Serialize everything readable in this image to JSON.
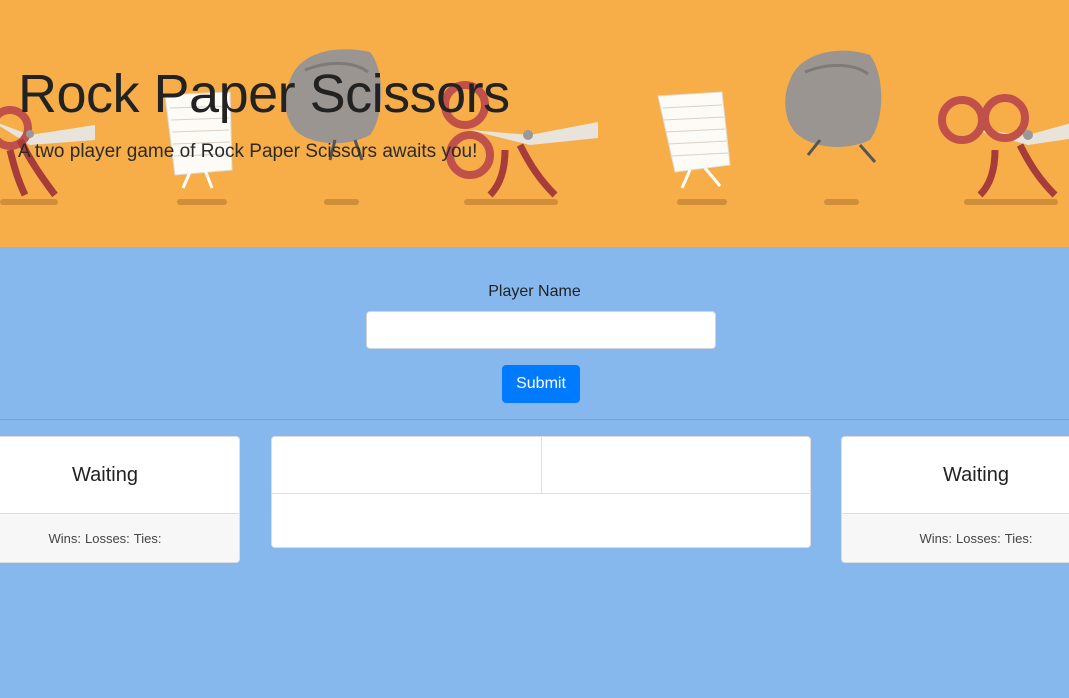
{
  "header": {
    "title": "Rock Paper Scissors",
    "subtitle": "A two player game of Rock Paper Scissors awaits you!",
    "banner_icons": [
      "scissors-icon",
      "paper-icon",
      "rock-icon"
    ],
    "background_color": "#f7ae48"
  },
  "form": {
    "label": "Player Name",
    "input_value": "",
    "submit_label": "Submit"
  },
  "players": [
    {
      "status": "Waiting",
      "wins_label": "Wins:",
      "losses_label": "Losses:",
      "ties_label": "Ties:"
    },
    {
      "status": "Waiting",
      "wins_label": "Wins:",
      "losses_label": "Losses:",
      "ties_label": "Ties:"
    }
  ],
  "colors": {
    "page_background": "#86b8ee",
    "banner": "#f7ae48",
    "primary_button": "#007bff",
    "scissors": "#c0504a",
    "rock": "#9a9591",
    "paper": "#ffffff"
  }
}
